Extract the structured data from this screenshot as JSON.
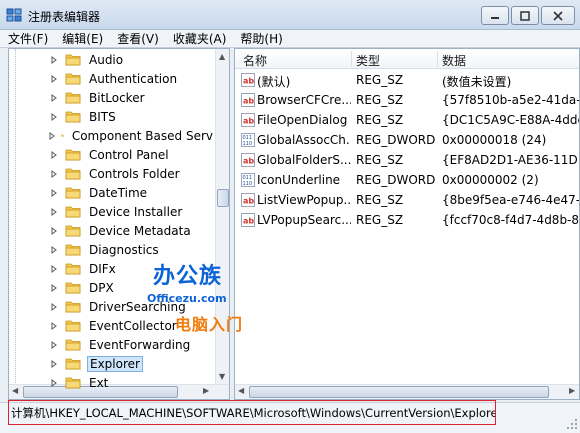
{
  "window": {
    "title": "注册表编辑器",
    "controls": {
      "minimize": "minimize-icon",
      "maximize": "maximize-icon",
      "close": "close-icon"
    }
  },
  "menu": [
    "文件(F)",
    "编辑(E)",
    "查看(V)",
    "收藏夹(A)",
    "帮助(H)"
  ],
  "tree": {
    "items": [
      {
        "label": "Audio"
      },
      {
        "label": "Authentication"
      },
      {
        "label": "BitLocker"
      },
      {
        "label": "BITS"
      },
      {
        "label": "Component Based Serv"
      },
      {
        "label": "Control Panel"
      },
      {
        "label": "Controls Folder"
      },
      {
        "label": "DateTime"
      },
      {
        "label": "Device Installer"
      },
      {
        "label": "Device Metadata"
      },
      {
        "label": "Diagnostics"
      },
      {
        "label": "DIFx"
      },
      {
        "label": "DPX"
      },
      {
        "label": "DriverSearching"
      },
      {
        "label": "EventCollector"
      },
      {
        "label": "EventForwarding"
      },
      {
        "label": "Explorer",
        "selected": true
      },
      {
        "label": "Ext"
      }
    ]
  },
  "list": {
    "headers": {
      "name": "名称",
      "type": "类型",
      "data": "数据"
    },
    "rows": [
      {
        "icon": "string-value-icon",
        "name": "(默认)",
        "type": "REG_SZ",
        "data": "(数值未设置)"
      },
      {
        "icon": "string-value-icon",
        "name": "BrowserCFCre...",
        "type": "REG_SZ",
        "data": "{57f8510b-a5e2-41da-a"
      },
      {
        "icon": "string-value-icon",
        "name": "FileOpenDialog",
        "type": "REG_SZ",
        "data": "{DC1C5A9C-E88A-4dde-"
      },
      {
        "icon": "dword-value-icon",
        "name": "GlobalAssocCh...",
        "type": "REG_DWORD",
        "data": "0x00000018 (24)"
      },
      {
        "icon": "string-value-icon",
        "name": "GlobalFolderS...",
        "type": "REG_SZ",
        "data": "{EF8AD2D1-AE36-11D1-"
      },
      {
        "icon": "dword-value-icon",
        "name": "IconUnderline",
        "type": "REG_DWORD",
        "data": "0x00000002 (2)"
      },
      {
        "icon": "string-value-icon",
        "name": "ListViewPopup...",
        "type": "REG_SZ",
        "data": "{8be9f5ea-e746-4e47-a"
      },
      {
        "icon": "string-value-icon",
        "name": "LVPopupSearc...",
        "type": "REG_SZ",
        "data": "{fccf70c8-f4d7-4d8b-8c"
      }
    ]
  },
  "watermark": {
    "main": "办公族",
    "sub": "Officezu.com",
    "tag": "电脑入门"
  },
  "status": {
    "path": "计算机\\HKEY_LOCAL_MACHINE\\SOFTWARE\\Microsoft\\Windows\\CurrentVersion\\Explorer"
  },
  "colors": {
    "selection": "#cfe5fb",
    "highlight_border": "#d9262e",
    "folder": "#f2c94c"
  }
}
